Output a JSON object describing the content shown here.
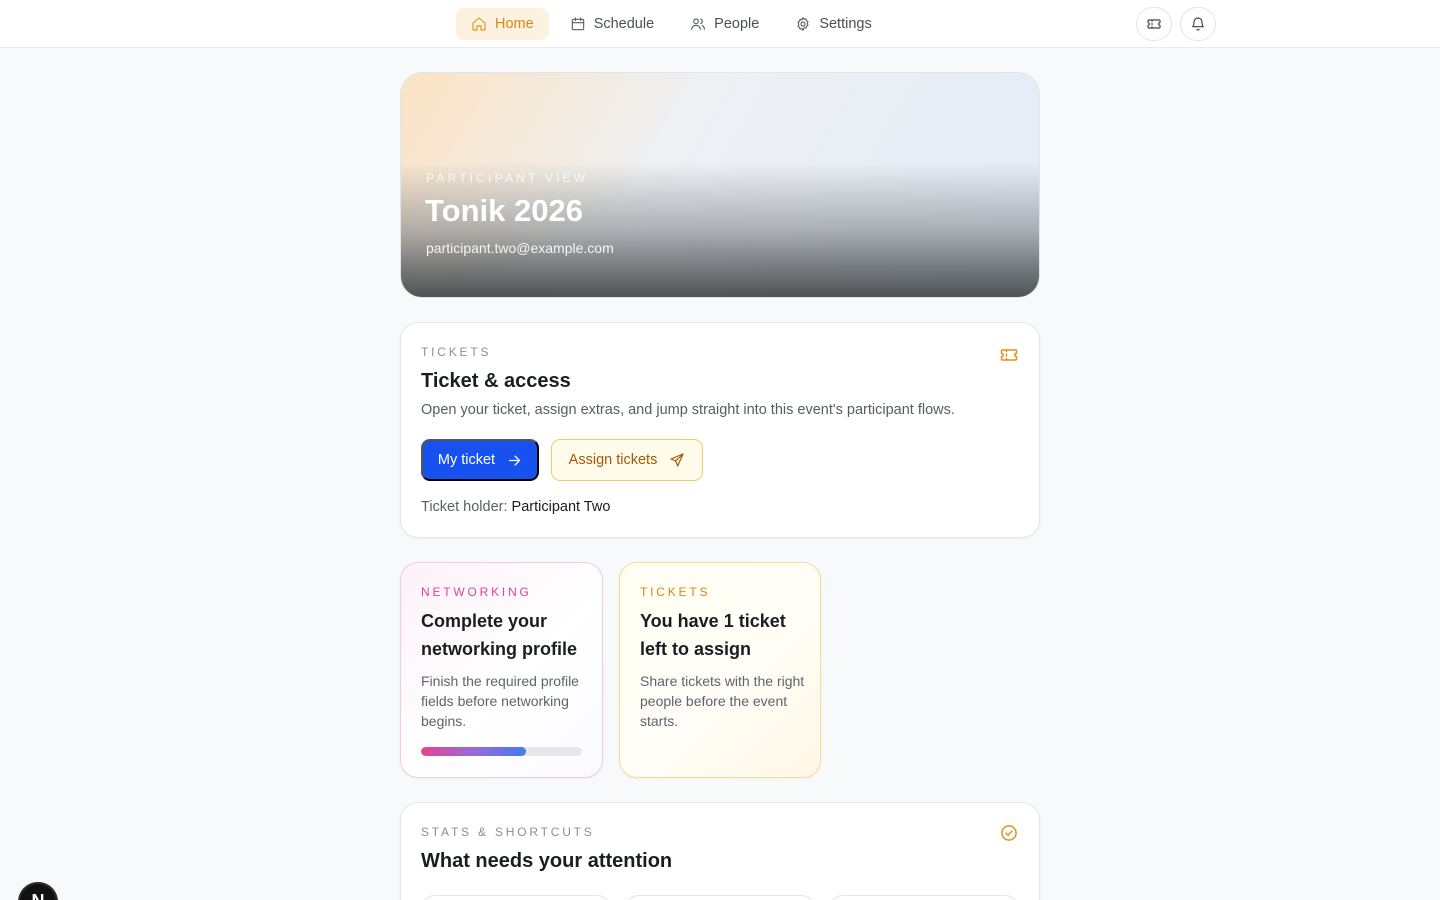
{
  "nav": {
    "items": [
      {
        "label": "Home",
        "icon": "home-icon",
        "active": true
      },
      {
        "label": "Schedule",
        "icon": "calendar-icon",
        "active": false
      },
      {
        "label": "People",
        "icon": "users-icon",
        "active": false
      },
      {
        "label": "Settings",
        "icon": "gear-icon",
        "active": false
      }
    ],
    "actions": [
      {
        "icon": "ticket-icon"
      },
      {
        "icon": "bell-icon"
      }
    ]
  },
  "hero": {
    "eyebrow": "PARTICIPANT VIEW",
    "title": "Tonik 2026",
    "email": "participant.two@example.com"
  },
  "ticket_card": {
    "eyebrow": "TICKETS",
    "title": "Ticket & access",
    "description": "Open your ticket, assign extras, and jump straight into this event's participant flows.",
    "primary_label": "My ticket",
    "secondary_label": "Assign tickets",
    "holder_prefix": "Ticket holder:",
    "holder_name": "Participant Two",
    "icon": "ticket-icon"
  },
  "networking_card": {
    "eyebrow": "NETWORKING",
    "title": "Complete your networking profile",
    "description": "Finish the required profile fields before networking begins.",
    "progress": 0.65
  },
  "tickets_card": {
    "eyebrow": "TICKETS",
    "title": "You have 1 ticket left to assign",
    "description": "Share tickets with the right people before the event starts."
  },
  "stats_card": {
    "eyebrow": "STATS & SHORTCUTS",
    "title": "What needs your attention",
    "icon": "check-circle-icon"
  },
  "badge": {
    "letter": "N"
  },
  "colors": {
    "accent": "#e09317",
    "primary": "#1752f0",
    "networking": "#e0448f"
  }
}
